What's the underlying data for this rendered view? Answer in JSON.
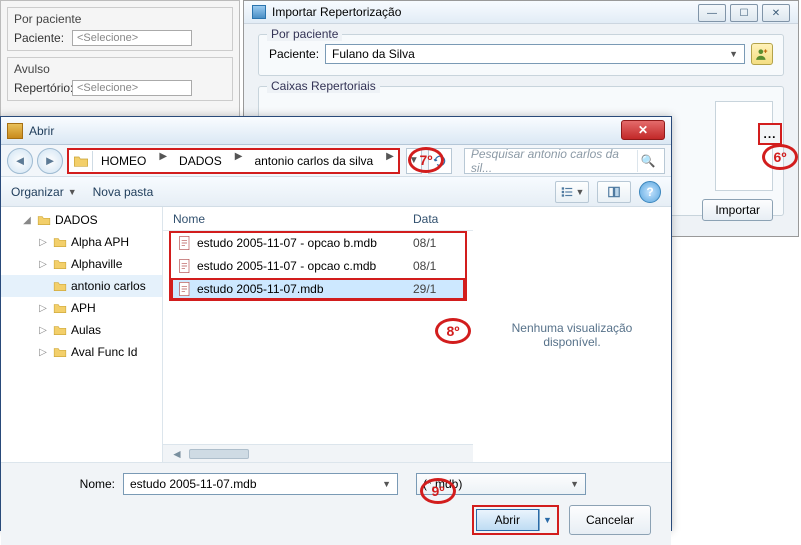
{
  "bg_window": {
    "group1_title": "Por paciente",
    "paciente_label": "Paciente:",
    "paciente_placeholder": "<Selecione>",
    "group2_title": "Avulso",
    "repertorio_label": "Repertório:",
    "repertorio_placeholder": "<Selecione>"
  },
  "import_window": {
    "title": "Importar Repertorização",
    "group_patient_title": "Por paciente",
    "paciente_label": "Paciente:",
    "paciente_value": "Fulano da Silva",
    "group_caixas_title": "Caixas Repertoriais",
    "browse_label": "...",
    "import_button": "Importar"
  },
  "open_dialog": {
    "title": "Abrir",
    "breadcrumb": {
      "segments": [
        "HOMEO",
        "DADOS",
        "antonio carlos da silva"
      ]
    },
    "search_placeholder": "Pesquisar antonio carlos da sil...",
    "toolbar": {
      "organize": "Organizar",
      "new_folder": "Nova pasta"
    },
    "tree": {
      "root": "DADOS",
      "children": [
        "Alpha APH",
        "Alphaville",
        "antonio carlos",
        "APH",
        "Aulas",
        "Aval Func Id"
      ]
    },
    "list": {
      "col_name": "Nome",
      "col_date": "Data",
      "rows": [
        {
          "name": "estudo 2005-11-07 - opcao b.mdb",
          "date": "08/1",
          "selected": false
        },
        {
          "name": "estudo 2005-11-07 - opcao c.mdb",
          "date": "08/1",
          "selected": false
        },
        {
          "name": "estudo 2005-11-07.mdb",
          "date": "29/1",
          "selected": true
        }
      ]
    },
    "preview_empty": "Nenhuma visualização disponível.",
    "footer": {
      "name_label": "Nome:",
      "name_value": "estudo 2005-11-07.mdb",
      "filter_value": "(*.mdb)",
      "open_button": "Abrir",
      "cancel_button": "Cancelar"
    }
  },
  "callouts": {
    "c6": "6º",
    "c7": "7º",
    "c8": "8º",
    "c9": "9º"
  }
}
